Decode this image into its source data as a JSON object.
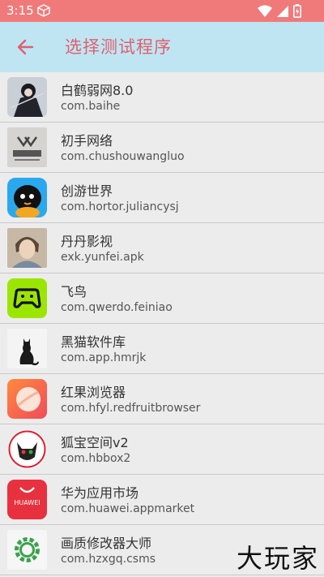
{
  "status_bar": {
    "time": "3:15"
  },
  "app_bar": {
    "title": "选择测试程序",
    "accent_color": "#e0606c",
    "background": "#bfe5f3"
  },
  "apps": [
    {
      "name": "白鹤弱网8.0",
      "package": "com.baihe",
      "icon": "anime-character-icon"
    },
    {
      "name": "初手网络",
      "package": "com.chushouwangluo",
      "icon": "chushou-logo-icon"
    },
    {
      "name": "创游世界",
      "package": "com.hortor.juliancysj",
      "icon": "chuangyou-mascot-icon"
    },
    {
      "name": "丹丹影视",
      "package": "exk.yunfei.apk",
      "icon": "portrait-icon"
    },
    {
      "name": "飞鸟",
      "package": "com.qwerdo.feiniao",
      "icon": "gamepad-icon"
    },
    {
      "name": "黑猫软件库",
      "package": "com.app.hmrjk",
      "icon": "black-cat-icon"
    },
    {
      "name": "红果浏览器",
      "package": "com.hfyl.redfruitbrowser",
      "icon": "red-fruit-icon"
    },
    {
      "name": "狐宝空间v2",
      "package": "com.hbbox2",
      "icon": "fox-avatar-icon"
    },
    {
      "name": "华为应用市场",
      "package": "com.huawei.appmarket",
      "icon": "huawei-bag-icon",
      "icon_text": "HUAWEI"
    },
    {
      "name": "画质修改器大师",
      "package": "com.hzxgq.csms",
      "icon": "green-gear-icon"
    }
  ],
  "watermark": "大玩家"
}
